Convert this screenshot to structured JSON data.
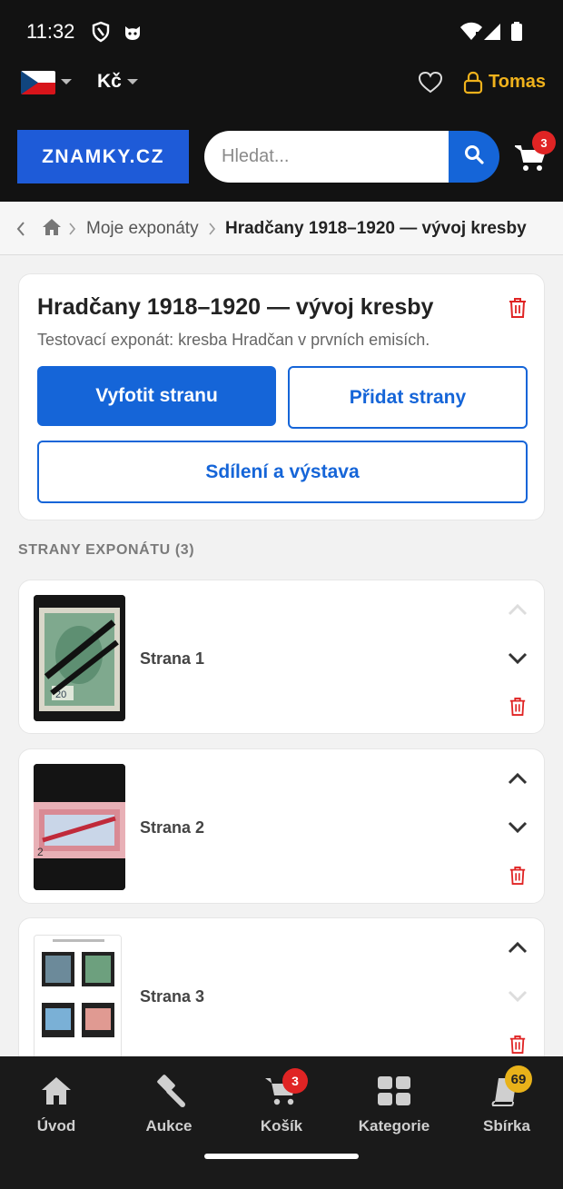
{
  "status_bar": {
    "time": "11:32"
  },
  "header": {
    "currency": "Kč",
    "user_name": "Tomas",
    "logo_text": "ZNAMKY.CZ",
    "search_placeholder": "Hledat...",
    "cart_count": "3"
  },
  "breadcrumb": {
    "items": [
      "Moje exponáty",
      "Hradčany 1918–1920 — vývoj kresby"
    ]
  },
  "exhibit": {
    "title": "Hradčany 1918–1920 — vývoj kresby",
    "description": "Testovací exponát: kresba Hradčan v prvních emisích.",
    "photo_button": "Vyfotit stranu",
    "add_pages_button": "Přidat strany",
    "share_button": "Sdílení a výstava"
  },
  "pages_section": {
    "label": "STRANY EXPONÁTU (3)",
    "pages": [
      {
        "label": "Strana 1",
        "move_up_enabled": false,
        "move_down_enabled": true
      },
      {
        "label": "Strana 2",
        "move_up_enabled": true,
        "move_down_enabled": true
      },
      {
        "label": "Strana 3",
        "move_up_enabled": true,
        "move_down_enabled": false
      }
    ]
  },
  "bottom_nav": {
    "items": [
      {
        "label": "Úvod",
        "icon": "home-icon"
      },
      {
        "label": "Aukce",
        "icon": "gavel-icon"
      },
      {
        "label": "Košík",
        "icon": "cart-icon",
        "badge": "3"
      },
      {
        "label": "Kategorie",
        "icon": "grid-icon"
      },
      {
        "label": "Sbírka",
        "icon": "album-icon",
        "badge": "69"
      }
    ]
  },
  "colors": {
    "primary": "#1565d8",
    "logo_bg": "#1e5bd8",
    "user_accent": "#f0b21c",
    "danger": "#e02424",
    "badge_gold": "#e8b21a",
    "header_bg": "#121212"
  }
}
